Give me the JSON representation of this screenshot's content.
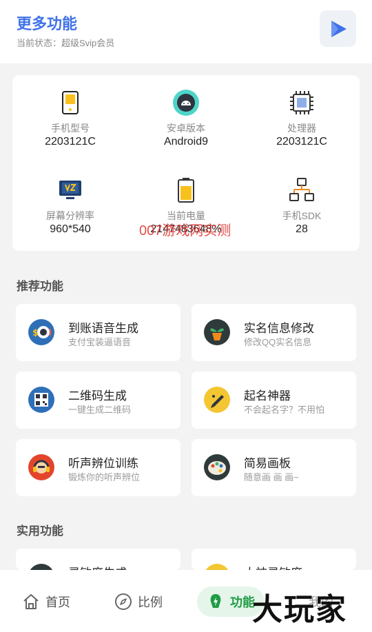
{
  "header": {
    "title": "更多功能",
    "subtitle": "当前状态：超级Svip会员"
  },
  "device_info": [
    {
      "label": "手机型号",
      "value": "2203121C"
    },
    {
      "label": "安卓版本",
      "value": "Android9"
    },
    {
      "label": "处理器",
      "value": "2203121C"
    },
    {
      "label": "屏幕分辨率",
      "value": "960*540"
    },
    {
      "label": "当前电量",
      "value": "2147483648%"
    },
    {
      "label": "手机SDK",
      "value": "28"
    }
  ],
  "watermark_overlay": "007游戏网实测",
  "sections": {
    "recommended": "推荐功能",
    "practical": "实用功能"
  },
  "recommended": [
    {
      "name": "到账语音生成",
      "desc": "支付宝装逼语音",
      "icon": "money-sound-icon"
    },
    {
      "name": "实名信息修改",
      "desc": "修改QQ实名信息",
      "icon": "plant-pot-icon"
    },
    {
      "name": "二维码生成",
      "desc": "一键生成二维码",
      "icon": "qr-code-icon"
    },
    {
      "name": "起名神器",
      "desc": "不会起名字？不用怕",
      "icon": "pen-icon"
    },
    {
      "name": "听声辨位训练",
      "desc": "锻炼你的听声辨位",
      "icon": "headphones-icon"
    },
    {
      "name": "简易画板",
      "desc": "随意画 画 画~",
      "icon": "palette-icon"
    }
  ],
  "practical": [
    {
      "name": "灵敏度生成",
      "icon": "sensitivity-icon"
    },
    {
      "name": "大神灵敏度",
      "icon": "pro-sensitivity-icon"
    }
  ],
  "tabs": [
    {
      "label": "首页",
      "icon": "home-icon",
      "active": false
    },
    {
      "label": "比例",
      "icon": "compass-icon",
      "active": false
    },
    {
      "label": "功能",
      "icon": "lightning-icon",
      "active": true
    },
    {
      "label": "我的",
      "icon": "user-icon",
      "active": false
    }
  ],
  "big_watermark": "大玩家"
}
